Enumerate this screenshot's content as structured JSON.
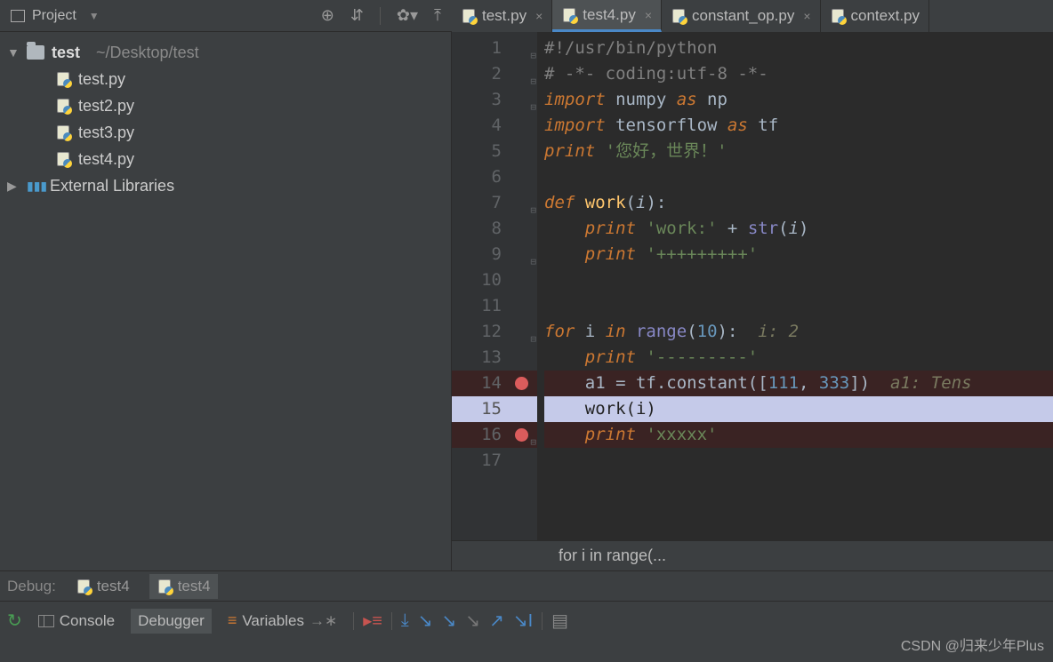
{
  "project": {
    "label": "Project",
    "root_name": "test",
    "root_path": "~/Desktop/test",
    "files": [
      "test.py",
      "test2.py",
      "test3.py",
      "test4.py"
    ],
    "external": "External Libraries"
  },
  "tabs": [
    {
      "name": "test.py",
      "active": false
    },
    {
      "name": "test4.py",
      "active": true
    },
    {
      "name": "constant_op.py",
      "active": false
    },
    {
      "name": "context.py",
      "active": false
    }
  ],
  "code": {
    "l1": {
      "c1": "#!/usr/bin/python"
    },
    "l2": {
      "c1": "# -*- coding:utf-8 -*-"
    },
    "l3": {
      "kw": "import",
      "rest": " numpy ",
      "kw2": "as",
      "rest2": " np"
    },
    "l4": {
      "kw": "import",
      "rest": " tensorflow ",
      "kw2": "as",
      "rest2": " tf"
    },
    "l5": {
      "kw": "print ",
      "str": "'您好，世界！'"
    },
    "l6": {
      "blank": ""
    },
    "l7": {
      "kw": "def ",
      "fn": "work",
      "p1": "(",
      "param": "i",
      "p2": "):"
    },
    "l8": {
      "indent": "    ",
      "kw": "print ",
      "s1": "'work:'",
      "op": " + ",
      "bi": "str",
      "p1": "(",
      "param": "i",
      "p2": ")"
    },
    "l9": {
      "indent": "    ",
      "kw": "print ",
      "str": "'+++++++++'"
    },
    "l10": {
      "blank": ""
    },
    "l11": {
      "blank": ""
    },
    "l12": {
      "kw": "for ",
      "v": "i ",
      "kw2": "in ",
      "bi": "range",
      "p1": "(",
      "n": "10",
      "p2": "):",
      "hint": "  i: 2"
    },
    "l13": {
      "indent": "    ",
      "kw": "print ",
      "str": "'---------'"
    },
    "l14": {
      "indent": "    ",
      "v": "a1 = tf.constant(",
      "p1": "[",
      "n1": "111",
      "c": ", ",
      "n2": "333",
      "p2": "])",
      "hint": "  a1: Tens"
    },
    "l15": {
      "indent": "    ",
      "fn": "work(i)"
    },
    "l16": {
      "indent": "    ",
      "kw": "print ",
      "str": "'xxxxx'"
    },
    "l17": {
      "blank": ""
    }
  },
  "line_numbers": [
    "1",
    "2",
    "3",
    "4",
    "5",
    "6",
    "7",
    "8",
    "9",
    "10",
    "11",
    "12",
    "13",
    "14",
    "15",
    "16",
    "17"
  ],
  "breadcrumb": "for i in range(...",
  "debug": {
    "label": "Debug:",
    "tabs": [
      "test4",
      "test4"
    ]
  },
  "bottom": {
    "console": "Console",
    "debugger": "Debugger",
    "variables": "Variables"
  },
  "watermark": "CSDN @归来少年Plus"
}
